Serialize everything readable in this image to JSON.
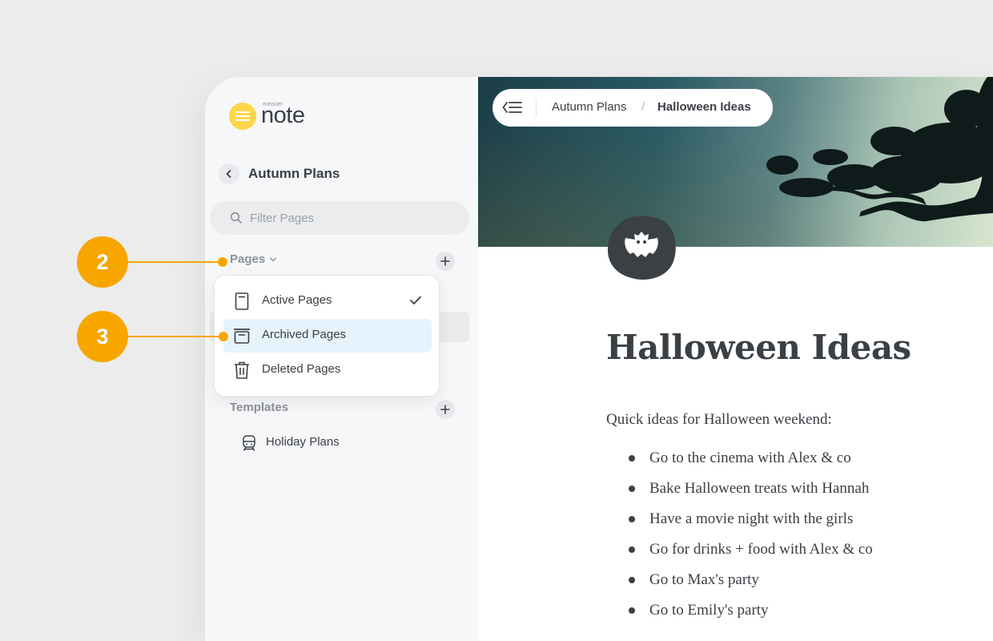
{
  "app": {
    "brand_small": "meister",
    "brand": "note"
  },
  "sidebar": {
    "back_title": "Autumn Plans",
    "filter_placeholder": "Filter Pages",
    "pages_heading": "Pages",
    "templates_heading": "Templates",
    "templates": [
      {
        "label": "Holiday Plans",
        "icon": "train-icon"
      }
    ]
  },
  "dropdown": {
    "items": [
      {
        "label": "Active Pages",
        "icon": "page-icon",
        "checked": true
      },
      {
        "label": "Archived Pages",
        "icon": "archive-icon",
        "highlighted": true
      },
      {
        "label": "Deleted Pages",
        "icon": "trash-icon"
      }
    ]
  },
  "header": {
    "breadcrumb": [
      "Autumn Plans",
      "Halloween Ideas"
    ],
    "separator": "/"
  },
  "document": {
    "icon": "bat-icon",
    "title": "Halloween Ideas",
    "intro": "Quick ideas for Halloween weekend:",
    "items": [
      "Go to the cinema with Alex & co",
      "Bake Halloween treats with Hannah",
      "Have a movie night with the girls",
      "Go for drinks + food with Alex & co",
      "Go to Max's party",
      "Go to Emily's party"
    ]
  },
  "callouts": [
    "2",
    "3"
  ],
  "colors": {
    "accent": "#f7a600",
    "logo": "#ffd54a",
    "highlight": "#e7f3fc",
    "text": "#3b4045"
  }
}
